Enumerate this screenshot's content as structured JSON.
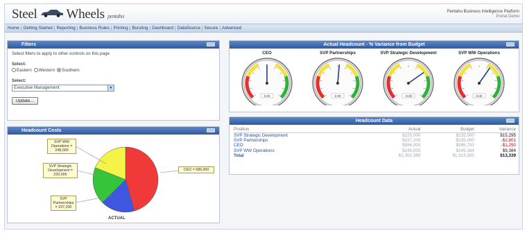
{
  "header": {
    "logo_left": "Steel",
    "logo_right": "Wheels",
    "logo_sub": "pentaho",
    "platform": "Pentaho Business Intelligence Platform",
    "platform_sub": "Portal Demo"
  },
  "nav": [
    "Home",
    "Getting Started",
    "Reporting",
    "Business Rules",
    "Printing",
    "Bursting",
    "Dashboard",
    "DataSource",
    "Secure",
    "Advanced"
  ],
  "filters": {
    "title": "Filters",
    "instruction": "Select filters to apply to other controls on this page",
    "region_label": "Select:",
    "regions": [
      {
        "label": "Eastern",
        "checked": false
      },
      {
        "label": "Western",
        "checked": false
      },
      {
        "label": "Southern",
        "checked": true
      }
    ],
    "dept_label": "Select:",
    "dept_value": "Executive Management",
    "update_label": "Update..."
  },
  "costs": {
    "title": "Headcount Costs",
    "caption": "ACTUAL",
    "slices": [
      {
        "label": "CEO = 586,000",
        "value": 586000,
        "color": "#f03a3a"
      },
      {
        "label": "SVP Strategic Development = 220,000",
        "value": 220000,
        "color": "#3f57e0"
      },
      {
        "label": "SVP Partnerships = 237,200",
        "value": 237200,
        "color": "#3f57e0"
      },
      {
        "label": "SVP WW Operations = 245,000",
        "value": 245000,
        "color": "#f3f348"
      }
    ],
    "callouts": {
      "ww": "SVP WW Operations = 248,000",
      "strat": "SVP Strategic Development = 220,000",
      "part": "SVP Partnerships = 237,200",
      "ceo": "CEO = 586,000"
    }
  },
  "headcount": {
    "title": "Actual Headcount - % Variance from Budget",
    "gauges": [
      {
        "title": "CEO",
        "value": "0.00",
        "needle": 0
      },
      {
        "title": "SVP Partnerships",
        "value": "0.00",
        "needle": 5
      },
      {
        "title": "SVP Strategic Development",
        "value": "-0.00",
        "needle": 55
      },
      {
        "title": "SVP WW Operations",
        "value": "0.00",
        "needle": 35
      }
    ]
  },
  "data": {
    "title": "Headcount Data",
    "columns": [
      "Position",
      "Actual",
      "Budget",
      "Variance"
    ],
    "rows": [
      {
        "position": "SVP Strategic Development",
        "actual": "$220,000",
        "budget": "$235,000",
        "variance": "$15,295",
        "neg": false
      },
      {
        "position": "SVP Partnerships",
        "actual": "$237,200",
        "budget": "$235,000",
        "variance": "-$2,801",
        "neg": true
      },
      {
        "position": "CEO",
        "actual": "$586,000",
        "budget": "$586,750",
        "variance": "-$1,250",
        "neg": true
      },
      {
        "position": "SVP WW Operations",
        "actual": "$245,000",
        "budget": "$245,384",
        "variance": "$9,384",
        "neg": false
      }
    ],
    "total": {
      "position": "Total",
      "actual": "$1,302,389",
      "budget": "$1,323,300",
      "variance": "$13,339"
    }
  },
  "colors": {
    "panel_header": "#2f5aa0",
    "nav_text": "#1b3d7a",
    "negative": "#c00000"
  }
}
